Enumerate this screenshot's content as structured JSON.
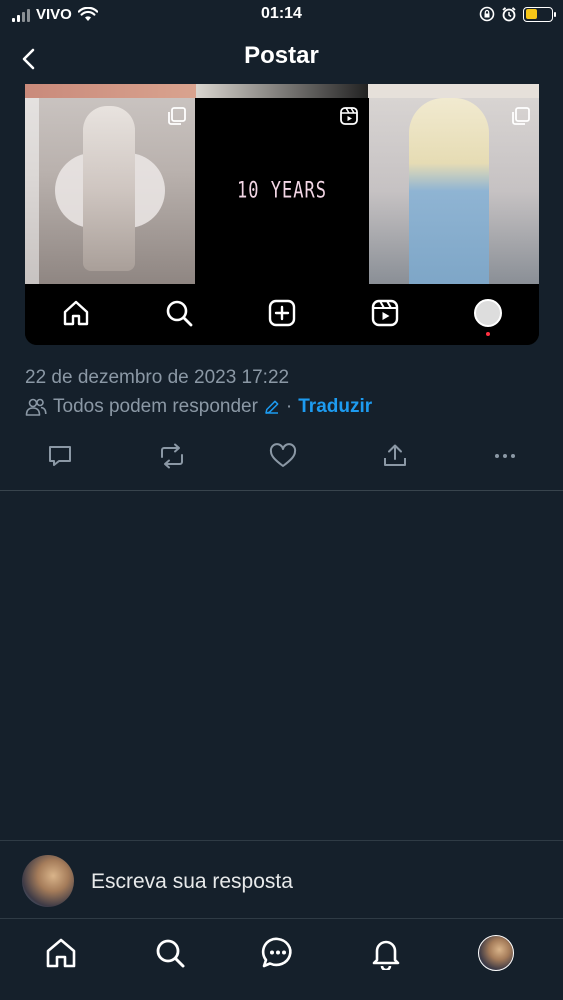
{
  "status_bar": {
    "carrier": "VIVO",
    "time": "01:14",
    "battery_level": 0.45,
    "battery_color": "#f5c518",
    "icons": [
      "signal-icon",
      "wifi-icon",
      "screen-lock-icon",
      "alarm-icon",
      "battery-icon"
    ]
  },
  "header": {
    "title": "Postar",
    "back_icon": "chevron-left-icon"
  },
  "embedded_image": {
    "tile_text": "10 YEARS",
    "nav_icons": [
      "home-icon",
      "search-icon",
      "create-icon",
      "reels-icon",
      "profile-avatar"
    ]
  },
  "post": {
    "date": "22 de dezembro de 2023 17:22",
    "audience": "Todos podem responder",
    "separator": "·",
    "translate": "Traduzir"
  },
  "actions": [
    "reply-icon",
    "repost-icon",
    "like-icon",
    "share-icon",
    "more-icon"
  ],
  "reply_bar": {
    "placeholder": "Escreva sua resposta"
  },
  "bottom_nav": {
    "items": [
      "home-icon",
      "search-icon",
      "messages-icon",
      "notifications-icon",
      "profile-avatar"
    ]
  },
  "colors": {
    "background": "#15202b",
    "accent": "#1d9bf0",
    "muted_text": "#8b98a5",
    "divider": "#38444d"
  }
}
